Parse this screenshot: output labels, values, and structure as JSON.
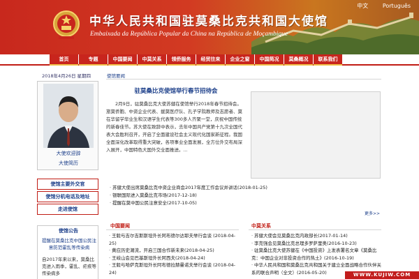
{
  "header": {
    "title": "中华人民共和国驻莫桑比克共和国大使馆",
    "subtitle": "Embaixada da República Popular da China na República de Moçambique",
    "languages": [
      "中文",
      "Português"
    ]
  },
  "nav": [
    "首页",
    "专题",
    "中国要闻",
    "中莫关系",
    "领侨服务",
    "经贸往来",
    "企业之窗",
    "中国简况",
    "莫桑概况",
    "联系我们"
  ],
  "left": {
    "date": "2018年4月26日  星期四",
    "photo_links": [
      "大使欢迎辞",
      "大使简历"
    ],
    "buttons": [
      "使馆主要外交官",
      "使馆分机电话及地址",
      "走进使馆"
    ],
    "notice_title": "使馆公告",
    "notice_link": "提醒在莫桑比克中国公民注意防范霍乱等传染病",
    "notice_body": "自2017年来以来，莫桑比克进入雨季，霍乱、疟疾等传染病多"
  },
  "main": {
    "breadcrumb": "使馆要闻",
    "headline": "驻莫桑比克使馆举行春节招待会",
    "article": "2月9日，驻莫桑比克大使苏健在使馆举行2018年春节招待会。旅莫侨胞、中资企业代表、援莫医疗队、孔子学院教师及志愿者、莫在华留学毕业生和汉语学生代表等300多人齐聚一堂，庆祝中国传统的新春佳节。苏大使在致辞中表示，去年中国共产党第十九次全国代表大会胜利召开，开启了全面建设社会主义现代化国家新征程。我国全面深化改革取得重大突破，各项事业全面发展，全方位外交布局深入展开，中国特色大国外交全面推进。...",
    "news": [
      "苏健大使出席莫桑比克中资企业商会2017年度工作会议并讲话(2018-01-25)",
      "银联国际进入莫桑比克市场(2017-12-18)",
      "提醒在莫中国公民注意安全(2017-10-05)"
    ],
    "more": "更多>>",
    "china_news_title": "中国要闻",
    "china_news": [
      "王毅与吉尔吉斯斯坦外长阿布德尔达耶夫举行会谈 (2018-04-25)",
      "黄应历史潮流，开启三国合作新未来(2018-04-25)",
      "王岐山会见巴基斯坦外长阿西夫(2018-04-24)",
      "王毅与哈萨克斯坦外长阿布德拉赫曼诺夫举行会谈 (2018-04-24)"
    ],
    "relations_title": "中莫关系",
    "relations": [
      "苏健大使会见莫桑比克内政部长(2017-01-14)",
      "李克强会见莫桑比克总理多罗萨里奥(2016-10-23)",
      "驻莫桑比克大使苏健在《中国投资》上发表署名文章《莫桑比克：中国企业对非投资合作的热土》(2016-10-19)",
      "中华人民共和国和莫桑比克共和国关于建立全面战略合作伙伴关系的联合声明（全文）(2016-05-20)"
    ]
  },
  "watermark": "WWW.KUJIW.COM"
}
